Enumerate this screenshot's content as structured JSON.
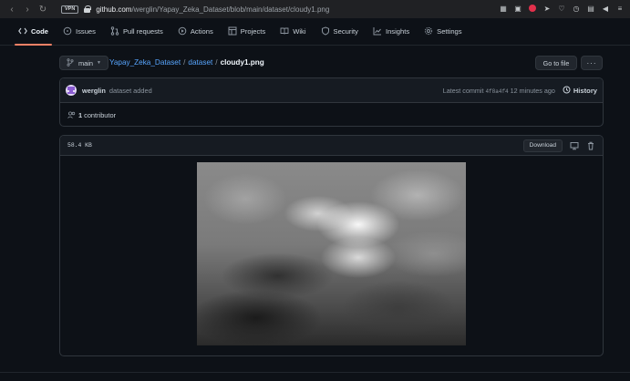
{
  "browser": {
    "vpn_label": "VPN",
    "url_host": "github.com",
    "url_path": "/werglin/Yapay_Zeka_Dataset/blob/main/dataset/cloudy1.png"
  },
  "repo_nav": {
    "tabs": [
      {
        "label": "Code",
        "icon": "code-icon",
        "active": true
      },
      {
        "label": "Issues",
        "icon": "issue-icon"
      },
      {
        "label": "Pull requests",
        "icon": "pull-request-icon"
      },
      {
        "label": "Actions",
        "icon": "play-icon"
      },
      {
        "label": "Projects",
        "icon": "table-icon"
      },
      {
        "label": "Wiki",
        "icon": "book-icon"
      },
      {
        "label": "Security",
        "icon": "shield-icon"
      },
      {
        "label": "Insights",
        "icon": "graph-icon"
      },
      {
        "label": "Settings",
        "icon": "gear-icon"
      }
    ]
  },
  "breadcrumb": {
    "branch": "main",
    "repo": "Yapay_Zeka_Dataset",
    "folder": "dataset",
    "file": "cloudy1.png",
    "sep": "/"
  },
  "actions": {
    "go_to_file": "Go to file",
    "more": "···"
  },
  "commit": {
    "author": "werglin",
    "message": "dataset added",
    "latest_prefix": "Latest commit",
    "sha": "4f8a4f4",
    "time": "12 minutes ago",
    "history": "History"
  },
  "contributors": {
    "count": "1",
    "label": "contributor"
  },
  "file": {
    "size": "58.4 KB",
    "download": "Download"
  },
  "colors": {
    "background": "#0d1117",
    "accent_tab": "#f78166",
    "link": "#58a6ff"
  }
}
